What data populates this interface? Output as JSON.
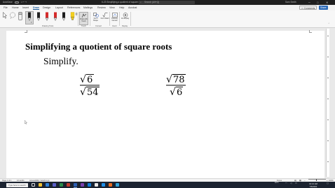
{
  "titlebar": {
    "autosave_label": "AutoSave",
    "autosave_state": "Off",
    "doc_title": "6-23 Simplifying a quotient of square roots • Last Modified: Now",
    "search_placeholder": "Search (Alt+Q)",
    "user_name": "Sam Smith",
    "search_icon": "search-icon",
    "minimize_glyph": "─",
    "maximize_glyph": "□",
    "close_glyph": "✕"
  },
  "ribbon_tabs": {
    "tabs": [
      {
        "label": "File"
      },
      {
        "label": "Home"
      },
      {
        "label": "Insert"
      },
      {
        "label": "Draw"
      },
      {
        "label": "Design"
      },
      {
        "label": "Layout"
      },
      {
        "label": "References"
      },
      {
        "label": "Mailings"
      },
      {
        "label": "Review"
      },
      {
        "label": "View"
      },
      {
        "label": "Help"
      },
      {
        "label": "Acrobat"
      }
    ],
    "active_tab": "Draw",
    "comments_label": "Comments",
    "share_label": "Share"
  },
  "ribbon": {
    "group_drawing_tools": "Drawing Tools",
    "group_touch": "Touch",
    "group_convert": "Convert",
    "group_insert": "Insert",
    "group_replay": "Replay",
    "draw_with_touch": "Draw with Touch",
    "ink_to_shape": "Ink to Shape",
    "ink_to_math": "Ink to Math",
    "drawing_canvas": "Drawing Canvas",
    "ink_replay": "Ink Replay",
    "pen_colors": [
      "#222222",
      "#222222",
      "#d42b2b",
      "#d42b2b",
      "#1d1d1d",
      "#2458c4",
      "#f4d020"
    ]
  },
  "document": {
    "heading": "Simplifying a quotient of square roots",
    "instruction": "Simplify.",
    "problem1": {
      "radical_sign": "√",
      "numerator": "6",
      "denominator": "54"
    },
    "problem2": {
      "radical_sign": "√",
      "numerator": "78",
      "denominator": "6"
    }
  },
  "statusbar": {
    "page_info": "Page 1 of 1",
    "word_count": "12 words",
    "accessibility": "Accessibility: Good to go",
    "focus": "Focus",
    "zoom": "100%"
  },
  "taskbar": {
    "search_placeholder": "Type here to search",
    "weather": "84°F",
    "time": "10:21 AM",
    "date": "7/6/2021"
  }
}
